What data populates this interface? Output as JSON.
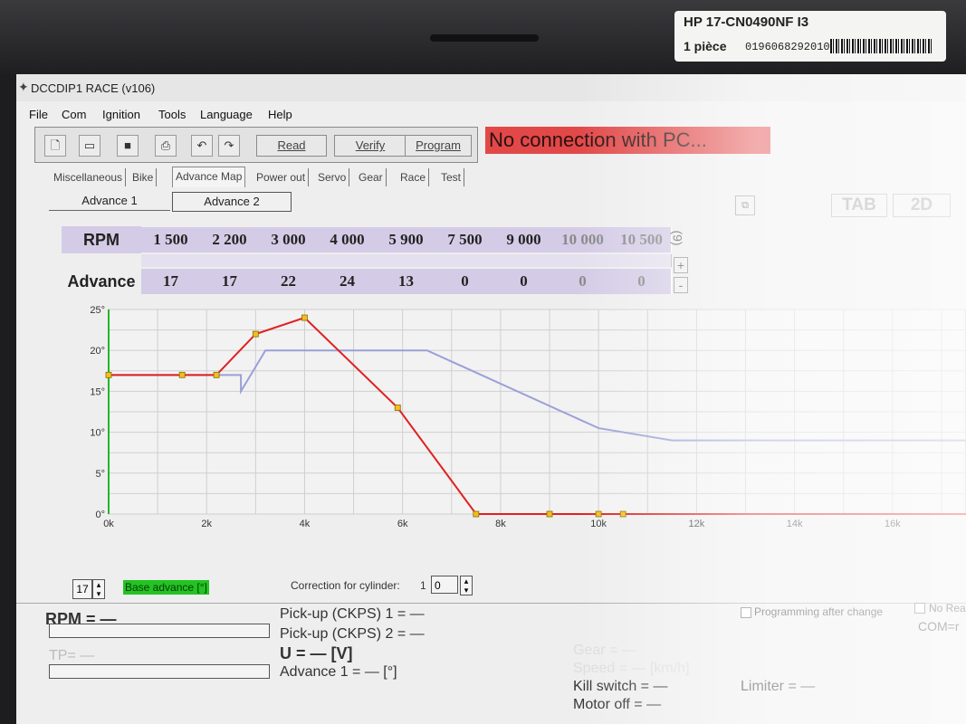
{
  "sticker": {
    "model": "HP 17-CN0490NF I3",
    "qty": "1 pièce",
    "code": "0196068292010"
  },
  "window": {
    "title": "DCCDIP1 RACE (v106)"
  },
  "menu": [
    "File",
    "Com",
    "Ignition",
    "Tools",
    "Language",
    "Help"
  ],
  "toolbar": {
    "icons": [
      "new-file-icon",
      "open-folder-icon",
      "save-icon",
      "print-icon",
      "undo-icon",
      "redo-icon"
    ],
    "read_label": "Read",
    "verify_label": "Verify",
    "program_label": "Program",
    "status": "No connection with PC..."
  },
  "tabs": [
    "Miscellaneous",
    "Bike",
    "Advance Map",
    "Power out",
    "Servo",
    "Gear",
    "Race",
    "Test"
  ],
  "subtabs": [
    "Advance 1",
    "Advance 2"
  ],
  "view_toggle": {
    "tab": "TAB",
    "twod": "2D"
  },
  "map": {
    "rpm_label": "RPM",
    "advance_label": "Advance",
    "count": "(9)",
    "plus": "+",
    "minus": "-",
    "rpm": [
      "1 500",
      "2 200",
      "3 000",
      "4 000",
      "5 900",
      "7 500",
      "9 000",
      "10 000",
      "10 500"
    ],
    "advance": [
      "17",
      "17",
      "22",
      "24",
      "13",
      "0",
      "0",
      "0",
      "0"
    ]
  },
  "chart_data": {
    "type": "line",
    "x_ticks": [
      "0k",
      "2k",
      "4k",
      "6k",
      "8k",
      "10k",
      "12k",
      "14k",
      "16k"
    ],
    "y_ticks": [
      "0°",
      "5°",
      "10°",
      "15°",
      "20°",
      "25°"
    ],
    "xlim": [
      0,
      17500
    ],
    "ylim": [
      0,
      25
    ],
    "grid": true,
    "series": [
      {
        "color": "#e02020",
        "x": [
          0,
          1500,
          2200,
          3000,
          4000,
          5900,
          7500,
          9000,
          10000,
          10500,
          17500
        ],
        "y": [
          17,
          17,
          17,
          22,
          24,
          13,
          0,
          0,
          0,
          0,
          0
        ],
        "points_x": [
          0,
          1500,
          2200,
          3000,
          4000,
          5900,
          7500,
          9000,
          10000,
          10500
        ],
        "points_y": [
          17,
          17,
          17,
          22,
          24,
          13,
          0,
          0,
          0,
          0
        ]
      },
      {
        "color": "#9aa0d8",
        "x": [
          0,
          2700,
          2700,
          3200,
          6500,
          10000,
          11500,
          17500
        ],
        "y": [
          17,
          17,
          15,
          20,
          20,
          10.5,
          9,
          9
        ]
      }
    ]
  },
  "controls": {
    "base_value": "17",
    "base_label": "Base advance [°]",
    "correction_label": "Correction for cylinder:",
    "cylinder_num": "1",
    "cylinder_value": "0"
  },
  "status_panel": {
    "rpm": "RPM = —",
    "tp": "TP= —",
    "pickup1": "Pick-up (CKPS) 1 = —",
    "pickup2": "Pick-up (CKPS) 2 = —",
    "voltage": "U = — [V]",
    "advance1": "Advance 1 = — [°]",
    "gear": "Gear = —",
    "speed": "Speed = — [km/h]",
    "kill": "Kill switch = —",
    "motor": "Motor off = —",
    "limiter": "Limiter = —",
    "programming": "Programming after change",
    "noread": "No Rea",
    "com": "COM=r"
  },
  "colors": {
    "status_bg": "#e24848",
    "table_bg": "#d4cce6",
    "base_label_bg": "#22c322"
  }
}
